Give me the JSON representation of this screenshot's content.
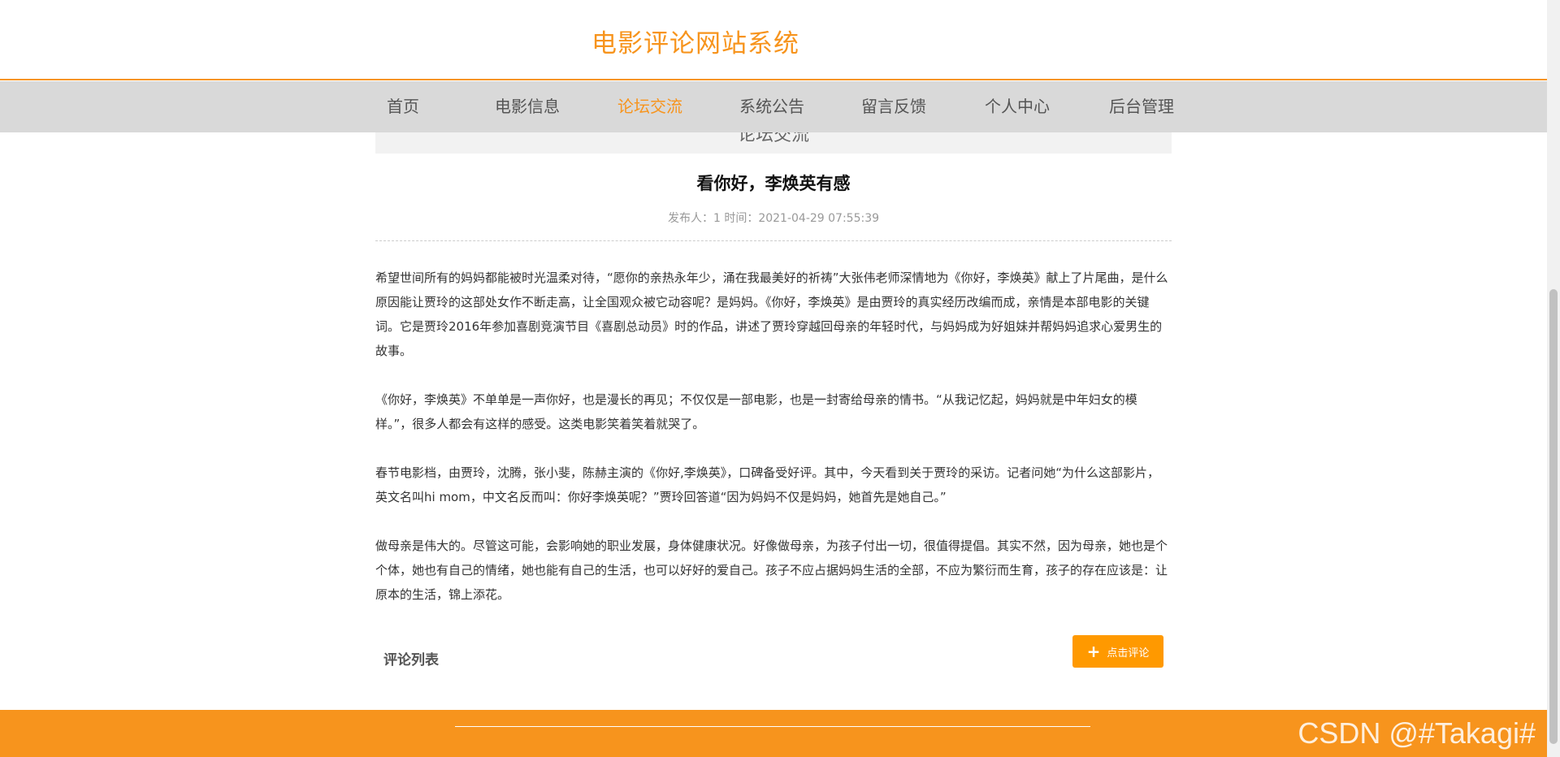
{
  "header": {
    "site_title": "电影评论网站系统"
  },
  "nav": {
    "items": [
      {
        "label": "首页"
      },
      {
        "label": "电影信息"
      },
      {
        "label": "论坛交流"
      },
      {
        "label": "系统公告"
      },
      {
        "label": "留言反馈"
      },
      {
        "label": "个人中心"
      },
      {
        "label": "后台管理"
      }
    ],
    "active_label": "论坛交流"
  },
  "section": {
    "title": "论坛交流"
  },
  "article": {
    "title": "看你好，李焕英有感",
    "meta": "发布人：1 时间：2021-04-29 07:55:39",
    "paragraphs": [
      "希望世间所有的妈妈都能被时光温柔对待，“愿你的亲热永年少，涌在我最美好的祈祷”大张伟老师深情地为《你好，李焕英》献上了片尾曲，是什么原因能让贾玲的这部处女作不断走高，让全国观众被它动容呢？是妈妈。《你好，李焕英》是由贾玲的真实经历改编而成，亲情是本部电影的关键词。它是贾玲2016年参加喜剧竞演节目《喜剧总动员》时的作品，讲述了贾玲穿越回母亲的年轻时代，与妈妈成为好姐妹并帮妈妈追求心爱男生的故事。",
      "《你好，李焕英》不单单是一声你好，也是漫长的再见；不仅仅是一部电影，也是一封寄给母亲的情书。“从我记忆起，妈妈就是中年妇女的模样。”，很多人都会有这样的感受。这类电影笑着笑着就哭了。",
      "春节电影档，由贾玲，沈腾，张小斐，陈赫主演的《你好,李焕英》，口碑备受好评。其中，今天看到关于贾玲的采访。记者问她“为什么这部影片，英文名叫hi mom，中文名反而叫：你好李焕英呢？”贾玲回答道“因为妈妈不仅是妈妈，她首先是她自己。”",
      "做母亲是伟大的。尽管这可能，会影响她的职业发展，身体健康状况。好像做母亲，为孩子付出一切，很值得提倡。其实不然，因为母亲，她也是个个体，她也有自己的情绪，她也能有自己的生活，也可以好好的爱自己。孩子不应占据妈妈生活的全部，不应为繁衍而生育，孩子的存在应该是：让原本的生活，锦上添花。"
    ]
  },
  "comments": {
    "label": "评论列表",
    "button_label": "点击评论",
    "button_icon": "plus-icon"
  },
  "footer": {
    "watermark": "CSDN @#Takagi#"
  },
  "colors": {
    "accent": "#f7941d",
    "nav_bg": "#d9d9d9",
    "button": "#ff9900"
  }
}
